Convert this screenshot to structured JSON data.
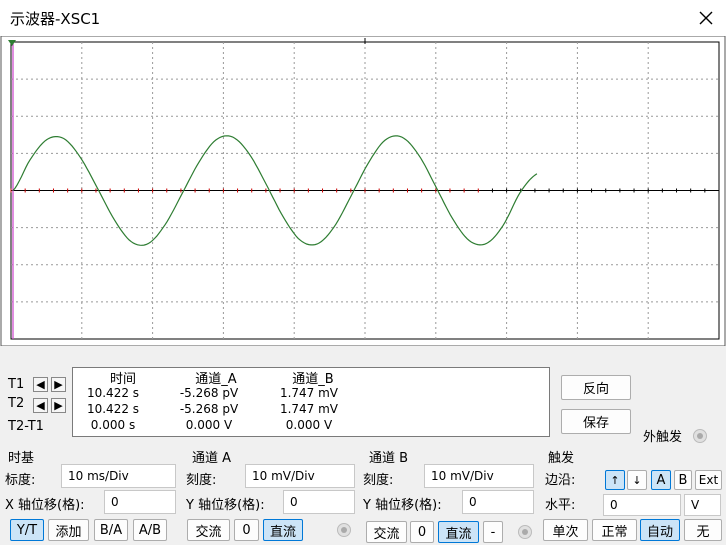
{
  "window": {
    "title": "示波器-XSC1",
    "close_icon": "close-icon"
  },
  "cursors": {
    "t1": "T1",
    "t2": "T2",
    "t2t1": "T2-T1"
  },
  "readout": {
    "headers": [
      "时间",
      "通道_A",
      "通道_B"
    ],
    "rows": [
      [
        "10.422 s",
        "-5.268 pV",
        "1.747 mV"
      ],
      [
        "10.422 s",
        "-5.268 pV",
        "1.747 mV"
      ],
      [
        "0.000 s",
        "0.000 V",
        "0.000 V"
      ]
    ]
  },
  "side_buttons": {
    "reverse": "反向",
    "save": "保存",
    "ext_trigger": "外触发"
  },
  "timebase": {
    "title": "时基",
    "scale_label": "标度:",
    "scale_value": "10 ms/Div",
    "xpos_label": "X 轴位移(格):",
    "xpos_value": "0",
    "modes": [
      "Y/T",
      "添加",
      "B/A",
      "A/B"
    ],
    "selected_mode": "Y/T"
  },
  "channel_a": {
    "title": "通道 A",
    "scale_label": "刻度:",
    "scale_value": "10 mV/Div",
    "ypos_label": "Y 轴位移(格):",
    "ypos_value": "0",
    "coupling": [
      "交流",
      "0",
      "直流"
    ],
    "selected": "直流"
  },
  "channel_b": {
    "title": "通道 B",
    "scale_label": "刻度:",
    "scale_value": "10 mV/Div",
    "ypos_label": "Y 轴位移(格):",
    "ypos_value": "0",
    "coupling": [
      "交流",
      "0",
      "直流",
      "-"
    ],
    "selected": "直流"
  },
  "trigger": {
    "title": "触发",
    "edge_label": "边沿:",
    "edge_buttons": [
      "↑",
      "↓"
    ],
    "source_buttons": [
      "A",
      "B",
      "Ext"
    ],
    "selected_source": "A",
    "level_label": "水平:",
    "level_value": "0",
    "level_unit": "V",
    "modes": [
      "单次",
      "正常",
      "自动",
      "无"
    ],
    "selected_mode": "自动"
  },
  "colors": {
    "trace": "#2e7d32",
    "grid": "#999999",
    "axis": "#000000",
    "cursor": "#cc44cc",
    "axis_marker": "#cc0000",
    "selected": "#cce4f7"
  },
  "chart_data": {
    "type": "line",
    "series": [
      {
        "values": [
          0,
          0.82,
          1.37,
          1.4,
          0.88,
          0.06,
          -0.79,
          -1.38,
          -1.43,
          -0.92,
          -0.09,
          0.76,
          1.36,
          1.44,
          0.97,
          0.15,
          -0.72,
          -1.34,
          -1.44,
          -0.98,
          -0.15,
          0.72,
          1.35,
          1.44,
          0.96,
          0.12,
          -0.75,
          -1.35,
          -1.43,
          -0.94,
          -0.06,
          0.45
        ]
      }
    ],
    "ylim": [
      -4,
      4
    ],
    "xlim": [
      0,
      10
    ],
    "grid": true
  }
}
